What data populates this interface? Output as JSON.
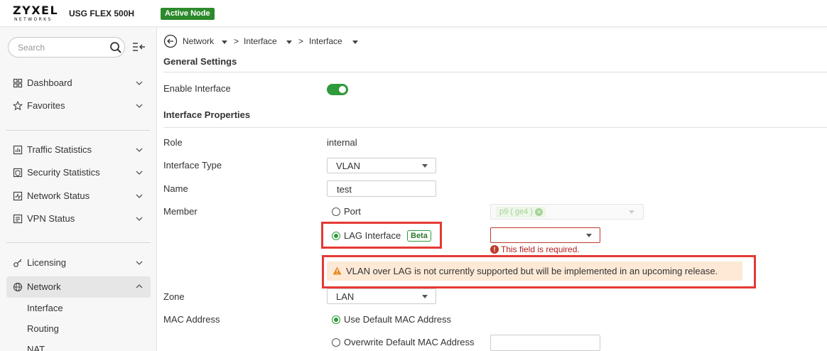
{
  "header": {
    "logo_main": "ZYXEL",
    "logo_sub": "NETWORKS",
    "model": "USG FLEX 500H",
    "node_badge": "Active Node"
  },
  "sidebar": {
    "search_placeholder": "Search",
    "items": [
      {
        "label": "Dashboard",
        "icon": "grid-icon"
      },
      {
        "label": "Favorites",
        "icon": "star-icon"
      },
      {
        "label": "Traffic Statistics",
        "icon": "traffic-stats-icon"
      },
      {
        "label": "Security Statistics",
        "icon": "security-stats-icon"
      },
      {
        "label": "Network Status",
        "icon": "network-status-icon"
      },
      {
        "label": "VPN Status",
        "icon": "vpn-status-icon"
      },
      {
        "label": "Licensing",
        "icon": "key-icon"
      },
      {
        "label": "Network",
        "icon": "globe-icon"
      }
    ],
    "network_subitems": [
      "Interface",
      "Routing",
      "NAT"
    ]
  },
  "breadcrumb": {
    "items": [
      "Network",
      "Interface",
      "Interface"
    ],
    "separator": ">"
  },
  "general": {
    "title": "General Settings",
    "enable_label": "Enable Interface",
    "enabled": true
  },
  "props": {
    "title": "Interface Properties",
    "role_label": "Role",
    "role_value": "internal",
    "type_label": "Interface Type",
    "type_value": "VLAN",
    "name_label": "Name",
    "name_value": "test",
    "member_label": "Member",
    "port_option": "Port",
    "port_chip": "p9 ( ge4 )",
    "lag_option": "LAG Interface",
    "lag_badge": "Beta",
    "lag_error_icon": "!",
    "lag_error": "This field is required.",
    "warning": "VLAN over LAG is not currently supported but will be implemented in an upcoming release.",
    "zone_label": "Zone",
    "zone_value": "LAN",
    "mac_label": "MAC Address",
    "mac_default": "Use Default MAC Address",
    "mac_overwrite": "Overwrite Default MAC Address"
  },
  "colors": {
    "accent_green": "#2e9a3a",
    "error_red": "#c0392b",
    "highlight_red": "#e53935",
    "warning_bg": "#fde9d6",
    "warning_icon": "#e8891f"
  }
}
